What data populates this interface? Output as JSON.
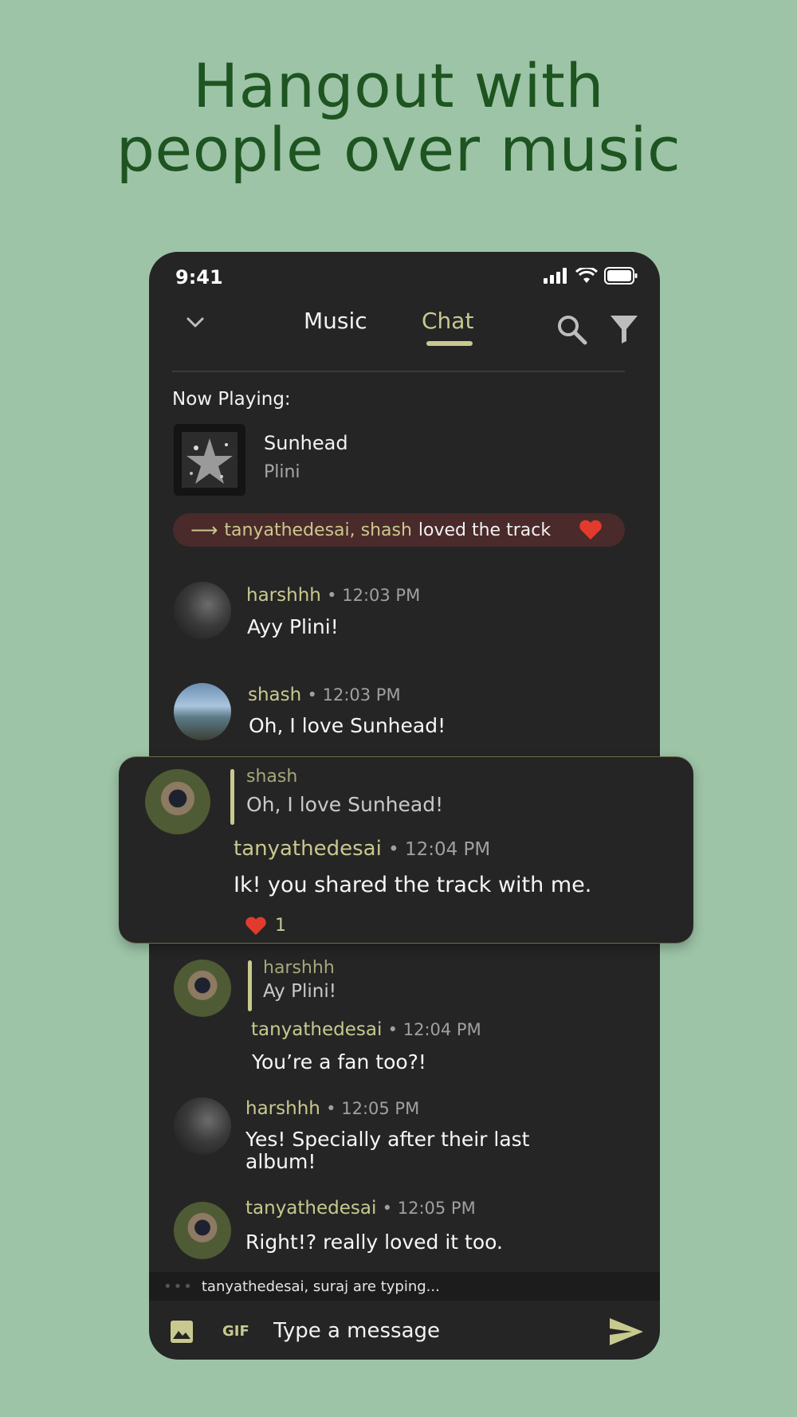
{
  "headline": {
    "line1": "Hangout with",
    "line2": "people over music"
  },
  "status_bar": {
    "time": "9:41"
  },
  "nav": {
    "tab_music": "Music",
    "tab_chat": "Chat",
    "active_tab": "Chat"
  },
  "now_playing": {
    "label": "Now Playing:",
    "title": "Sunhead",
    "artist": "Plini"
  },
  "loved": {
    "users": "tanyathedesai, shash",
    "text": "loved the track"
  },
  "messages": [
    {
      "user": "harshhh",
      "time": "• 12:03 PM",
      "text": "Ayy Plini!",
      "avatar": "harshhh"
    },
    {
      "user": "shash",
      "time": "• 12:03 PM",
      "text": "Oh, I love Sunhead!",
      "avatar": "shash"
    },
    {
      "quote_user": "shash",
      "quote_text": "Oh, I love Sunhead!",
      "user": "tanyathedesai",
      "time": "• 12:04 PM",
      "text": "Ik! you shared the track with me.",
      "reaction_count": "1",
      "avatar": "tanyathedesai"
    },
    {
      "quote_user": "harshhh",
      "quote_text": "Ay Plini!",
      "user": "tanyathedesai",
      "time": "• 12:04 PM",
      "text": "You’re a fan too?!",
      "avatar": "tanyathedesai"
    },
    {
      "user": "harshhh",
      "time": "• 12:05 PM",
      "text_line1": "Yes! Specially after their last",
      "text_line2": "album!",
      "avatar": "harshhh"
    },
    {
      "user": "tanyathedesai",
      "time": "• 12:05 PM",
      "text": "Right!? really loved it too.",
      "avatar": "tanyathedesai"
    }
  ],
  "typing": {
    "dots": "•••",
    "text": "tanyathedesai, suraj are typing..."
  },
  "composer": {
    "gif_label": "GIF",
    "placeholder": "Type a message"
  },
  "colors": {
    "background": "#9dc4a7",
    "headline": "#1d5420",
    "phone": "#252525",
    "accent": "#c8c98e",
    "heart": "#e23b2e"
  }
}
